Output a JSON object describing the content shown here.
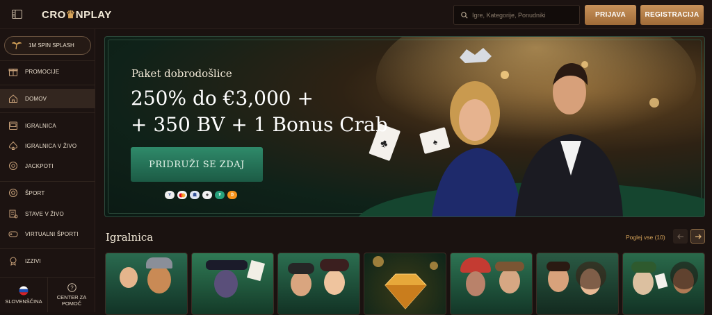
{
  "header": {
    "logo_pre": "CRO",
    "logo_post": "NPLAY",
    "search_placeholder": "Igre, Kategorije, Ponudniki",
    "login_label": "PRIJAVA",
    "register_label": "REGISTRACIJA"
  },
  "sidebar": {
    "spin_label": "1M SPIN SPLASH",
    "items": [
      {
        "label": "PROMOCIJE",
        "icon": "gift-icon"
      },
      {
        "label": "DOMOV",
        "icon": "home-icon",
        "active": true
      },
      {
        "label": "IGRALNICA",
        "icon": "slot-machine-icon"
      },
      {
        "label": "IGRALNICA V ŽIVO",
        "icon": "spade-icon"
      },
      {
        "label": "JACKPOTI",
        "icon": "chip-icon"
      },
      {
        "label": "ŠPORT",
        "icon": "football-icon"
      },
      {
        "label": "STAVE V ŽIVO",
        "icon": "live-bets-icon"
      },
      {
        "label": "VIRTUALNI ŠPORTI",
        "icon": "gamepad-icon"
      },
      {
        "label": "IZZIVI",
        "icon": "medal-icon"
      }
    ],
    "language_label": "SLOVENŠČINA",
    "help_label_line1": "CENTER ZA",
    "help_label_line2": "POMOČ"
  },
  "hero": {
    "subtitle": "Paket dobrodošlice",
    "title_line1": "250% do €3,000 +",
    "title_line2": "+ 350 BV + 1 Bonus Crab",
    "cta_label": "PRIDRUŽI SE ZDAJ",
    "payment_icons": [
      "visa-icon",
      "mastercard-icon",
      "bank-icon",
      "ethereum-icon",
      "tether-icon",
      "bitcoin-icon"
    ]
  },
  "games_section": {
    "title": "Igralnica",
    "view_all_label": "Poglej vse (10)",
    "tiles": [
      {
        "name": "viking-game-tile",
        "bg": "#1d4a3a"
      },
      {
        "name": "voodoo-game-tile",
        "bg": "#1f5a3e"
      },
      {
        "name": "pirates-game-tile",
        "bg": "#1a4e3c"
      },
      {
        "name": "diamond-game-tile",
        "bg": "#173f30"
      },
      {
        "name": "aztec-game-tile",
        "bg": "#1e5540"
      },
      {
        "name": "poker-couple-game-tile",
        "bg": "#24402f"
      },
      {
        "name": "joker-game-tile",
        "bg": "#1f4d36"
      }
    ]
  },
  "colors": {
    "gold": "#d7a45a",
    "cta_green": "#2f8a6a",
    "background": "#1a1210"
  }
}
